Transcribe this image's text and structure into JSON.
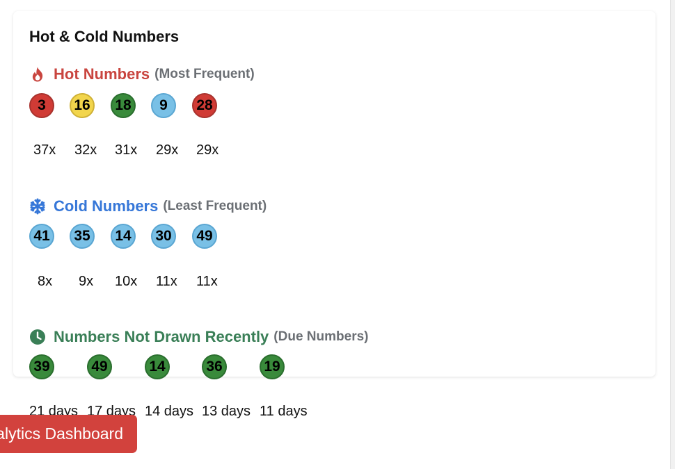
{
  "card": {
    "title": "Hot & Cold Numbers"
  },
  "hot": {
    "title": "Hot Numbers",
    "subtitle": "(Most Frequent)",
    "color": "#c9453f",
    "icon": "fire-icon",
    "balls": [
      {
        "number": "3",
        "color": "red",
        "count": "37x"
      },
      {
        "number": "16",
        "color": "yellow",
        "count": "32x"
      },
      {
        "number": "18",
        "color": "green",
        "count": "31x"
      },
      {
        "number": "9",
        "color": "blue",
        "count": "29x"
      },
      {
        "number": "28",
        "color": "red",
        "count": "29x"
      }
    ]
  },
  "cold": {
    "title": "Cold Numbers",
    "subtitle": "(Least Frequent)",
    "color": "#3677d8",
    "icon": "snowflake-icon",
    "balls": [
      {
        "number": "41",
        "color": "blue",
        "count": "8x"
      },
      {
        "number": "35",
        "color": "blue",
        "count": "9x"
      },
      {
        "number": "14",
        "color": "blue",
        "count": "10x"
      },
      {
        "number": "30",
        "color": "blue",
        "count": "11x"
      },
      {
        "number": "49",
        "color": "blue",
        "count": "11x"
      }
    ]
  },
  "due": {
    "title": "Numbers Not Drawn Recently",
    "subtitle": "(Due Numbers)",
    "color": "#3a7f57",
    "icon": "clock-icon",
    "balls": [
      {
        "number": "39",
        "color": "green",
        "days": "21 days"
      },
      {
        "number": "49",
        "color": "green",
        "days": "17 days"
      },
      {
        "number": "14",
        "color": "green",
        "days": "14 days"
      },
      {
        "number": "36",
        "color": "green",
        "days": "13 days"
      },
      {
        "number": "19",
        "color": "green",
        "days": "11 days"
      }
    ]
  },
  "analytics_button": {
    "label": "Analytics Dashboard"
  }
}
